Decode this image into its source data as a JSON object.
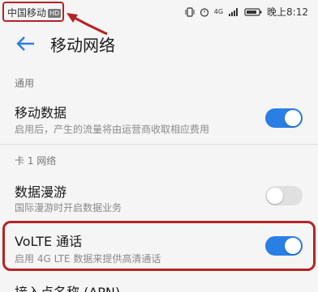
{
  "status_bar": {
    "carrier": "中国移动",
    "hd_badge": "HD",
    "time": "晚上8:12",
    "network_type": "4G"
  },
  "header": {
    "title": "移动网络"
  },
  "sections": {
    "general": {
      "label": "通用",
      "mobile_data": {
        "title": "移动数据",
        "subtitle": "启用后，产生的流量将由运营商收取相应费用",
        "enabled": true
      }
    },
    "card1": {
      "label": "卡 1 网络",
      "data_roaming": {
        "title": "数据漫游",
        "subtitle": "国际漫游时开启数据业务",
        "enabled": false
      },
      "volte": {
        "title": "VoLTE 通话",
        "subtitle": "启用 4G LTE 数据来提供高清通话",
        "enabled": true
      },
      "apn": {
        "title": "接入点名称 (APN)"
      }
    }
  },
  "colors": {
    "accent": "#2a7fe5",
    "annotation": "#b32424"
  }
}
